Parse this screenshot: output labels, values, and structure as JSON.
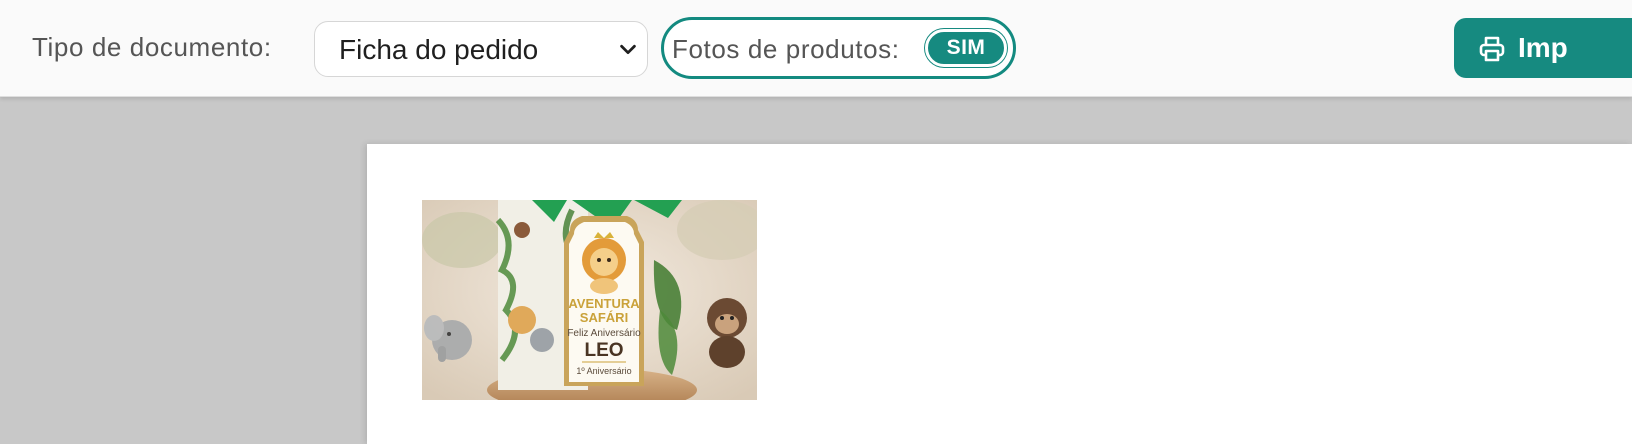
{
  "toolbar": {
    "document_type_label": "Tipo de documento:",
    "document_type_value": "Ficha do pedido",
    "product_photos_label": "Fotos de produtos:",
    "product_photos_toggle": "SIM",
    "print_button_label": "Imp"
  },
  "preview": {
    "product_image": {
      "headline": [
        "AVENTURA",
        "SAFÁRI"
      ],
      "greeting": "Feliz Aniversário",
      "name": "LEO",
      "age_line": "1º Aniversário"
    }
  },
  "colors": {
    "accent": "#168a80",
    "toolbar_bg": "#fafafa",
    "preview_bg": "#c8c8c8",
    "sheet_bg": "#ffffff"
  },
  "icons": {
    "select_chevron": "chevron-down-icon",
    "print": "printer-icon"
  }
}
